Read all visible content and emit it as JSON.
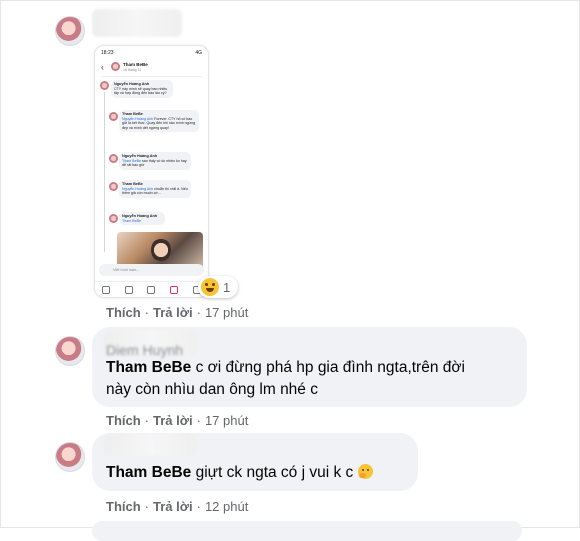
{
  "reply": {
    "thumbnail": {
      "status_time": "18:23",
      "status_right": "4G",
      "thread_title": "Tham BeBe",
      "thread_subtitle": "16 tháng 11",
      "compose_placeholder": "Viết bình luận...",
      "comments": [
        {
          "author": "Nguyễn Hoàng Anh",
          "text": "CTY này mình sẽ quay bao nhiêu tập và hợp đồng đến bao lâu cy?"
        },
        {
          "author": "Tham BeBe",
          "mention": "Nguyễn Hoàng Anh",
          "text": "Forever. CTY hỏ có bao giờ là kết thúc. Quay đến khi nào mình ngừng đẹp và mình dết ngừng quay!"
        },
        {
          "author": "Nguyễn Hoàng Anh",
          "mention": "Tham BeBe",
          "text": "sao thấy có dc nhiều ko hay dễ rất bao giờ"
        },
        {
          "author": "Tham BeBe",
          "mention": "Nguyễn Hoàng Anh",
          "text": "chuẩn thì chill á. Nếu thêm giả còn muốn cờ..."
        },
        {
          "author": "Nguyễn Hoàng Anh",
          "mention": "Tham BeBe",
          "text": ""
        }
      ]
    },
    "reaction_count": "1",
    "actions": {
      "like": "Thích",
      "reply": "Trả lời",
      "time": "17 phút"
    }
  },
  "comments": [
    {
      "author_visible": "Diem Huynh",
      "tag": "Tham BeBe",
      "text_line1": " c ơi đừng phá hp gia đình ngta,trên đời",
      "text_line2": "này còn nhìu dan ông lm nhé c",
      "like": "Thích",
      "reply": "Trả lời",
      "time": "17 phút"
    },
    {
      "tag": "Tham BeBe",
      "text": " giựt ck ngta có j vui k c",
      "like": "Thích",
      "reply": "Trả lời",
      "time": "12 phút"
    }
  ]
}
